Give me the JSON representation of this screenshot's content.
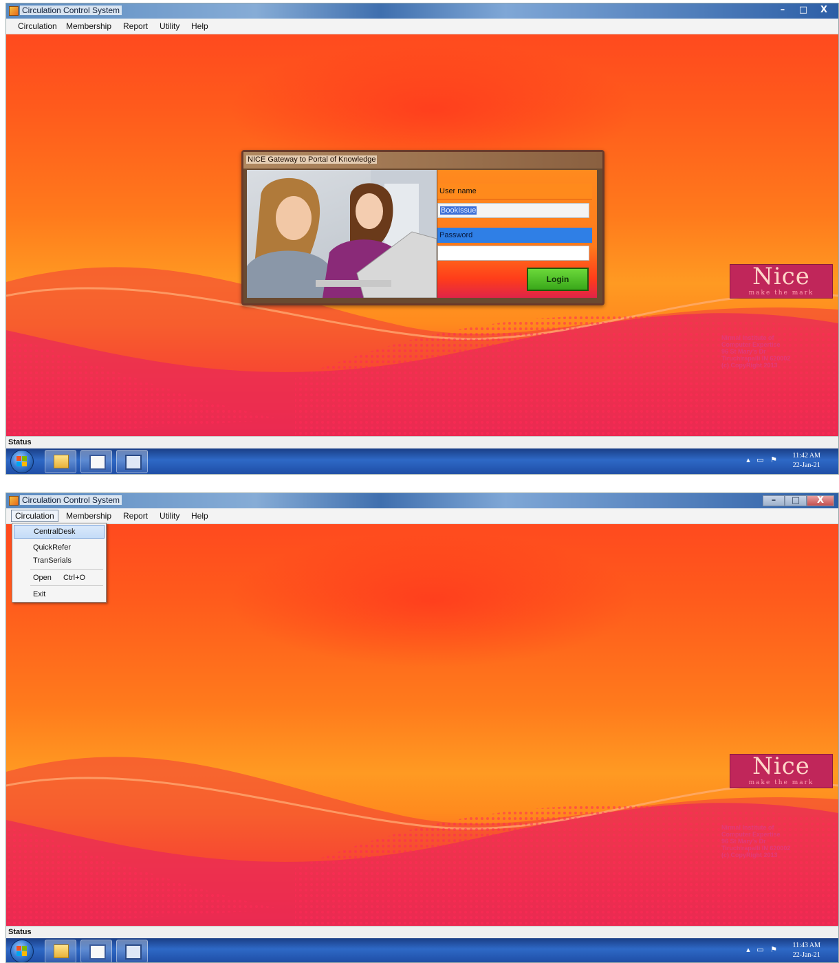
{
  "screen1": {
    "window_title": "Circulation Control System",
    "menu": [
      "Circulation",
      "Membership",
      "Report",
      "Utility",
      "Help"
    ],
    "login_dialog": {
      "title": "NICE Gateway to Portal of Knowledge",
      "username_label": "User name",
      "username_value": "BookIssue",
      "password_label": "Password",
      "password_value": "",
      "login_button": "Login"
    },
    "logo": {
      "text": "Nice",
      "tagline": "make the mark"
    },
    "credits": [
      "Nirmal Institute of",
      "Computer Expertise",
      "96 St Mary's Dr",
      "Tiruchirapalli IN 620002",
      "(c) CopyRight 2013"
    ],
    "status": "Status",
    "clock": {
      "time": "11:42 AM",
      "date": "22-Jan-21"
    },
    "window_controls": [
      "–",
      "□",
      "X"
    ]
  },
  "screen2": {
    "window_title": "Circulation Control System",
    "menu": [
      "Circulation",
      "Membership",
      "Report",
      "Utility",
      "Help"
    ],
    "open_menu": "Circulation",
    "dropdown": [
      {
        "label": "CentralDesk",
        "shortcut": "",
        "highlighted": true
      },
      {
        "label": "QuickRefer",
        "shortcut": ""
      },
      {
        "label": "TranSerials",
        "shortcut": ""
      },
      {
        "label": "Open",
        "shortcut": "Ctrl+O"
      },
      {
        "label": "Exit",
        "shortcut": ""
      }
    ],
    "logo": {
      "text": "Nice",
      "tagline": "make the mark"
    },
    "credits": [
      "Nirmal Institute of",
      "Computer Expertise",
      "96 St Mary's Dr",
      "Tiruchirapalli IN 620002",
      "(c) CopyRight 2013"
    ],
    "status": "Status",
    "clock": {
      "time": "11:43 AM",
      "date": "22-Jan-21"
    },
    "window_controls": [
      "–",
      "□",
      "X"
    ]
  },
  "taskbar": {
    "icons": [
      "start-orb",
      "folder-icon",
      "app-icon",
      "window-icon"
    ],
    "tray": "▴ ▭ ⚑"
  },
  "colors": {
    "titlebar": "#3f6fae",
    "background_orange": "#ff7a1c",
    "background_red": "#ec2244",
    "logo": "#c0265a",
    "login_button": "#4fc028",
    "taskbar": "#2e69c6"
  }
}
